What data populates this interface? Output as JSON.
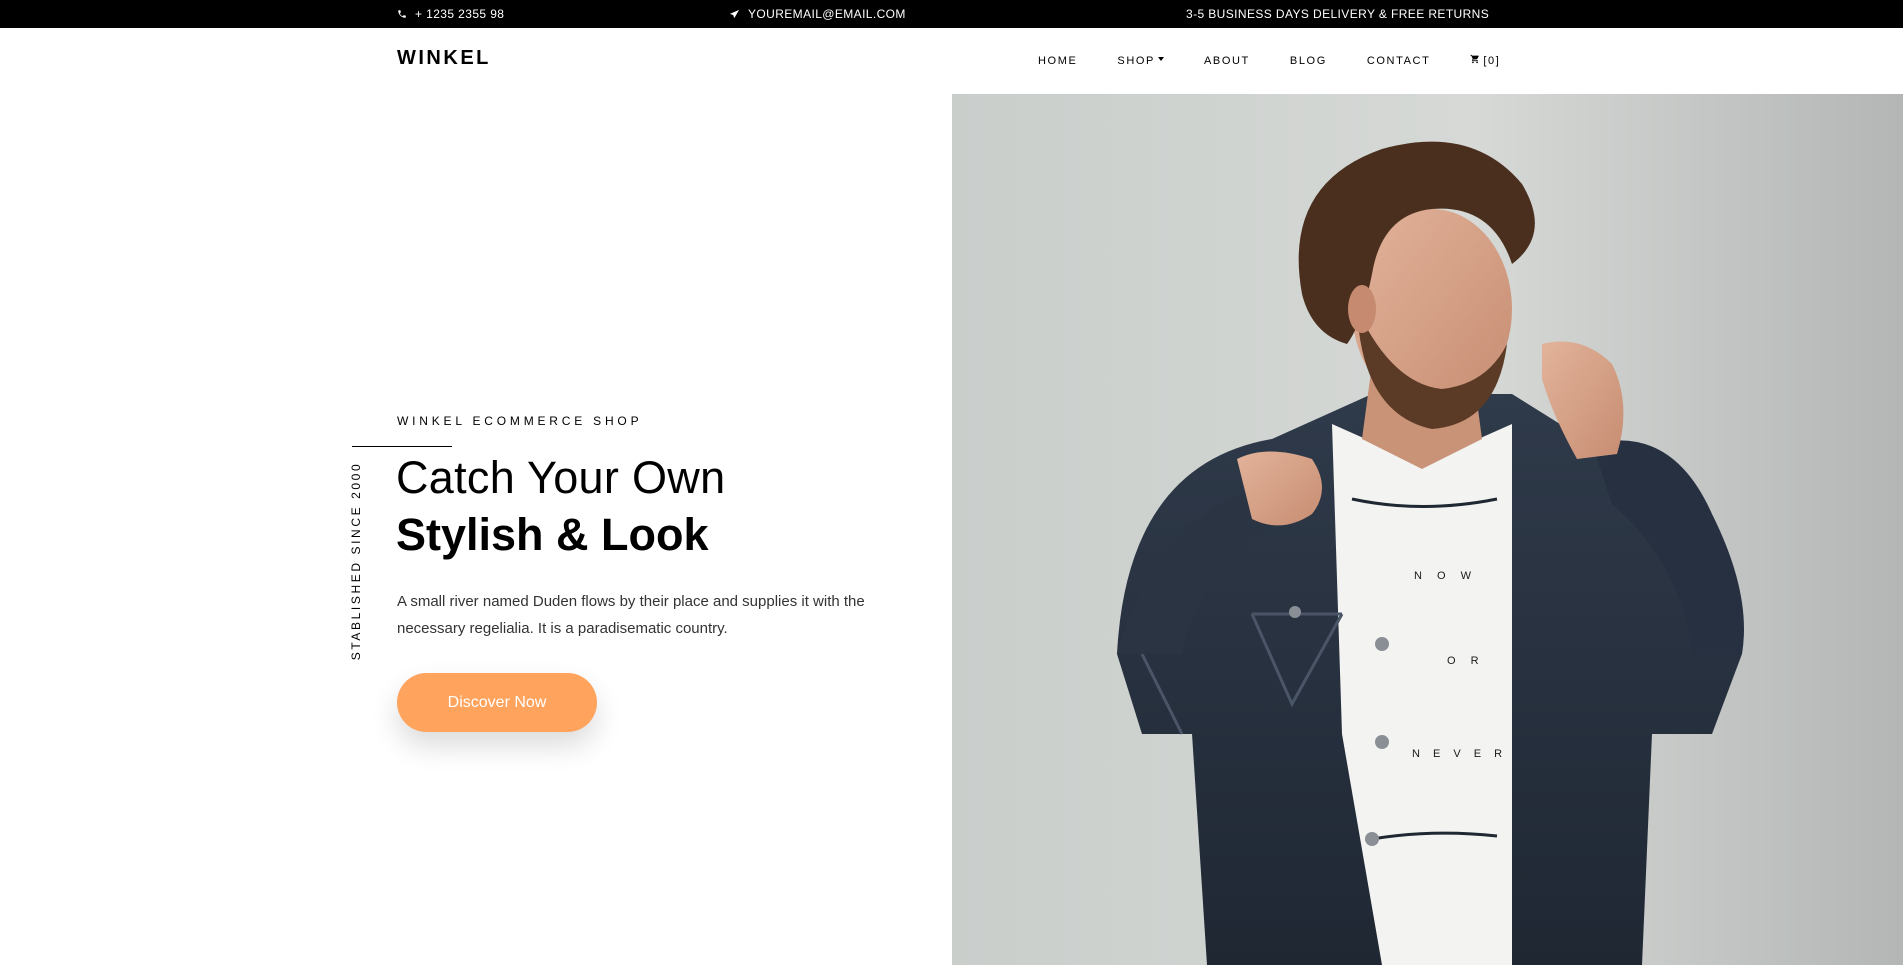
{
  "topbar": {
    "phone": "+ 1235 2355 98",
    "email": "YOUREMAIL@EMAIL.COM",
    "delivery": "3-5 BUSINESS DAYS DELIVERY & FREE RETURNS",
    "phone_icon": "phone-icon",
    "email_icon": "paper-plane-icon"
  },
  "navbar": {
    "brand": "WINKEL",
    "links": [
      "HOME",
      "SHOP",
      "ABOUT",
      "BLOG",
      "CONTACT"
    ],
    "cart_label": "[0]",
    "cart_icon": "cart-icon",
    "dropdown_icon": "caret-down-icon"
  },
  "hero": {
    "vertical_text": "STABLISHED SINCE 2000",
    "subheading": "WINKEL ECOMMERCE SHOP",
    "heading_light": "Catch Your Own",
    "heading_bold": "Stylish & Look",
    "description": "A small river named Duden flows by their place and supplies it with the necessary regelialia. It is a paradisematic country.",
    "cta_label": "Discover Now",
    "tshirt_text": [
      "N O W",
      "O R",
      "N E V E R"
    ]
  },
  "colors": {
    "accent": "#ffa35d",
    "topbar_bg": "#000000",
    "text": "#000000",
    "body_text": "#333333"
  }
}
